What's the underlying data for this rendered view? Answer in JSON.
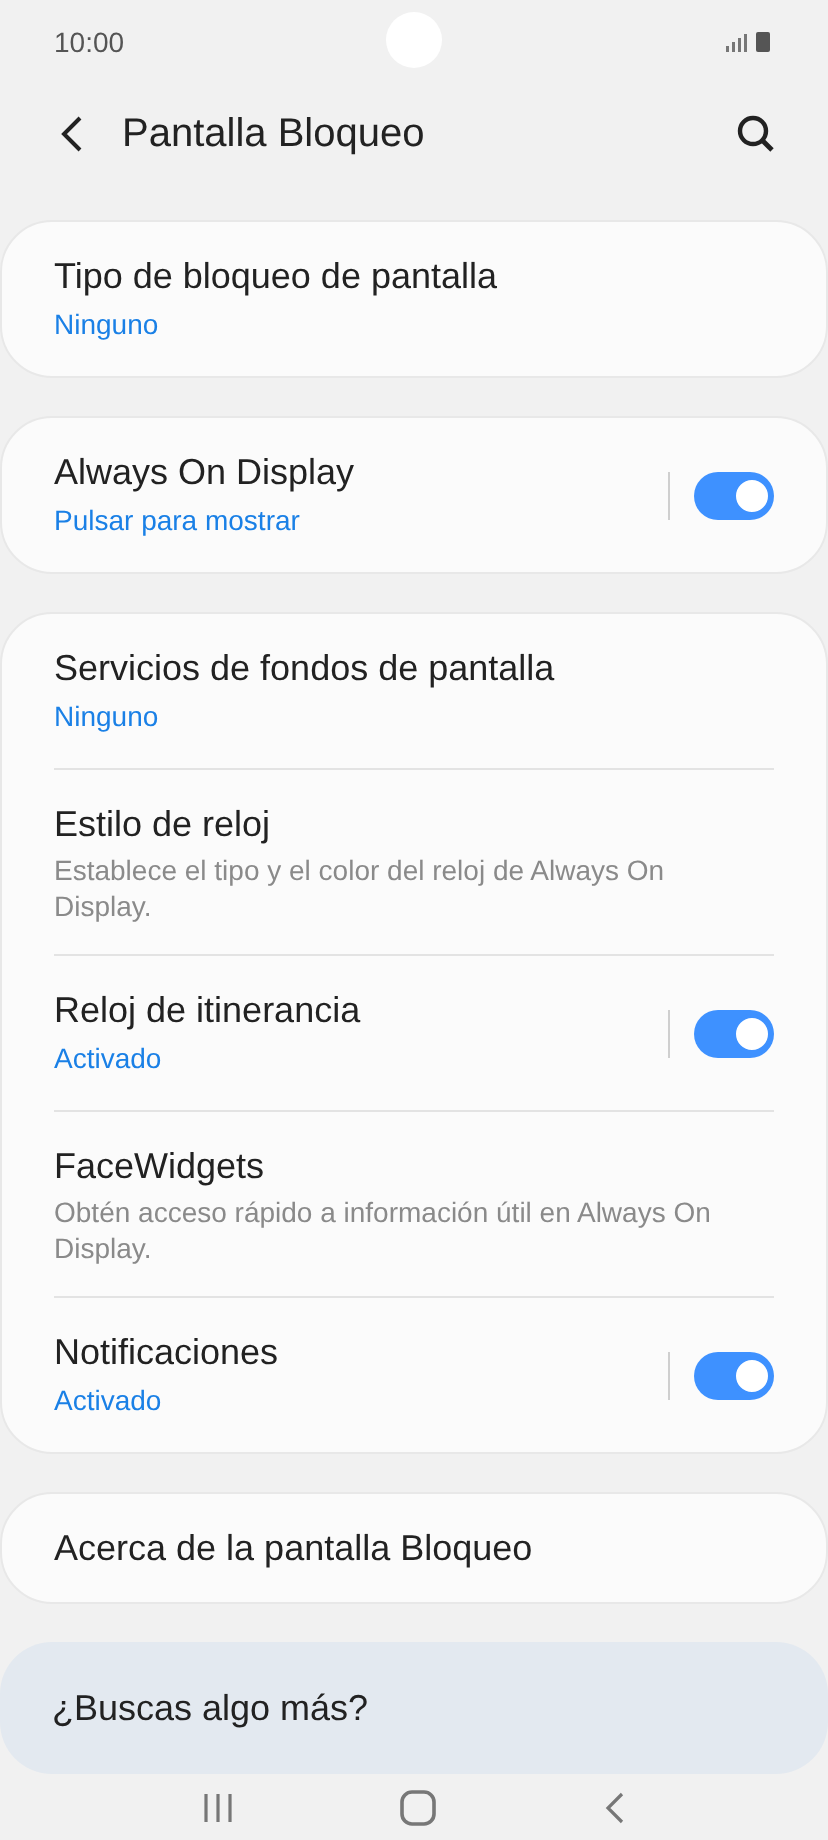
{
  "status_bar": {
    "time": "10:00"
  },
  "header": {
    "title": "Pantalla Bloqueo"
  },
  "groups": [
    {
      "items": [
        {
          "kind": "link",
          "title": "Tipo de bloqueo de pantalla",
          "value": "Ninguno"
        }
      ]
    },
    {
      "items": [
        {
          "kind": "toggle",
          "title": "Always On Display",
          "value": "Pulsar para mostrar",
          "on": true
        }
      ]
    },
    {
      "items": [
        {
          "kind": "link",
          "title": "Servicios de fondos de pantalla",
          "value": "Ninguno"
        },
        {
          "kind": "link",
          "title": "Estilo de reloj",
          "description": "Establece el tipo y el color del reloj de Always On Display."
        },
        {
          "kind": "toggle",
          "title": "Reloj de itinerancia",
          "value": "Activado",
          "on": true
        },
        {
          "kind": "link",
          "title": "FaceWidgets",
          "description": "Obtén acceso rápido a información útil en Always On Display."
        },
        {
          "kind": "toggle",
          "title": "Notificaciones",
          "value": "Activado",
          "on": true
        }
      ]
    },
    {
      "items": [
        {
          "kind": "link",
          "title": "Acerca de la pantalla Bloqueo"
        }
      ]
    }
  ],
  "suggestion": {
    "title": "¿Buscas algo más?"
  }
}
